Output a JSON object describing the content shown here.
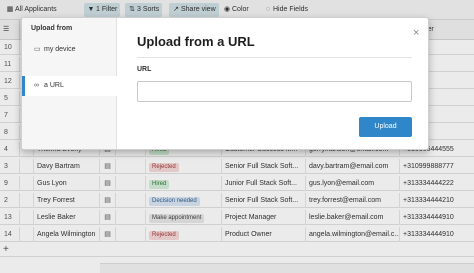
{
  "toolbar": {
    "view_label": "All Applicants",
    "filter_label": "1 Filter",
    "sorts_label": "3 Sorts",
    "share_label": "Share view",
    "color_label": "Color",
    "hide_label": "Hide Fields"
  },
  "grid": {
    "visible_header_fragment": "e Number",
    "rows": [
      {
        "num": "10",
        "name": "",
        "status": "",
        "status_color": "",
        "position": "",
        "email": "",
        "phone": ""
      },
      {
        "num": "11",
        "name": "",
        "status": "",
        "status_color": "",
        "position": "",
        "email": "",
        "phone": ""
      },
      {
        "num": "12",
        "name": "",
        "status": "",
        "status_color": "",
        "position": "",
        "email": "",
        "phone": ""
      },
      {
        "num": "5",
        "name": "",
        "status": "",
        "status_color": "",
        "position": "",
        "email": "",
        "phone": "4445"
      },
      {
        "num": "7",
        "name": "",
        "status": "",
        "status_color": "",
        "position": "",
        "email": "",
        "phone": "4415"
      },
      {
        "num": "8",
        "name": "",
        "status": "",
        "status_color": "",
        "position": "",
        "email": "",
        "phone": "4445"
      },
      {
        "num": "4",
        "name": "Thelma Everly",
        "status": "Hired",
        "status_color": "green",
        "position": "Customer Success M...",
        "email": "gerry.hanson@email.com",
        "phone": "+310666444555",
        "expand": "1"
      },
      {
        "num": "3",
        "name": "Davy Bartram",
        "status": "Rejected",
        "status_color": "red",
        "position": "Senior Full Stack Soft...",
        "email": "davy.bartram@email.com",
        "phone": "+310999888777"
      },
      {
        "num": "9",
        "name": "Gus Lyon",
        "status": "Hired",
        "status_color": "green",
        "position": "Junior Full Stack Soft...",
        "email": "gus.lyon@email.com",
        "phone": "+313334444222"
      },
      {
        "num": "2",
        "name": "Trey Forrest",
        "status": "Decision needed",
        "status_color": "blue",
        "position": "Senior Full Stack Soft...",
        "email": "trey.forrest@email.com",
        "phone": "+313334444210"
      },
      {
        "num": "13",
        "name": "Leslie Baker",
        "status": "Make appointment",
        "status_color": "gray",
        "position": "Project Manager",
        "email": "leslie.baker@email.com",
        "phone": "+313334444910"
      },
      {
        "num": "14",
        "name": "Angela Wilmington",
        "status": "Rejected",
        "status_color": "red",
        "position": "Product Owner",
        "email": "angela.wilmington@email.c...",
        "phone": "+313334444910"
      }
    ]
  },
  "modal": {
    "side_title": "Upload from",
    "side_items": [
      {
        "label": "my device",
        "icon": "monitor-icon"
      },
      {
        "label": "a URL",
        "icon": "link-icon"
      }
    ],
    "title": "Upload from a URL",
    "close_glyph": "×",
    "url_label": "URL",
    "url_value": "",
    "url_placeholder": "",
    "upload_label": "Upload"
  },
  "colors": {
    "accent": "#2f86c9",
    "toolbar_active": "#cfe0e4"
  }
}
